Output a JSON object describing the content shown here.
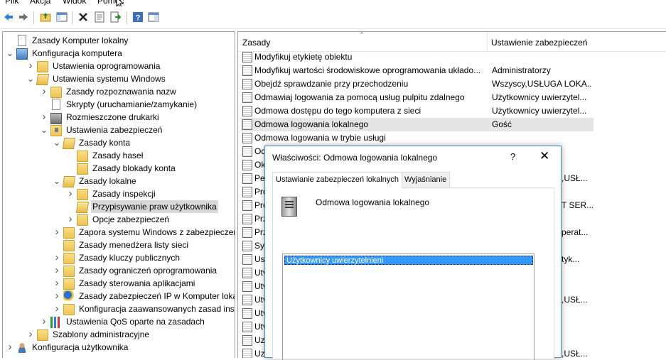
{
  "menu": [
    "Plik",
    "Akcja",
    "Widok",
    "Pomoc"
  ],
  "toolbar": {
    "icons": [
      "back-arrow-icon",
      "forward-arrow-icon",
      "up-folder-icon",
      "show-hide-tree-icon",
      "delete-icon",
      "properties-icon",
      "export-list-icon",
      "help-icon",
      "show-pane-icon"
    ]
  },
  "tree": [
    {
      "label": "Zasady Komputer lokalny",
      "icon": "policy-doc-icon",
      "expander": ""
    },
    {
      "label": "Konfiguracja komputera",
      "icon": "computer-icon",
      "expander": "v"
    },
    {
      "label": "Ustawienia oprogramowania",
      "icon": "folder-icon",
      "expander": ">"
    },
    {
      "label": "Ustawienia systemu Windows",
      "icon": "folder-open-icon",
      "expander": "v"
    },
    {
      "label": "Zasady rozpoznawania nazw",
      "icon": "folder-icon",
      "expander": ">"
    },
    {
      "label": "Skrypty (uruchamianie/zamykanie)",
      "icon": "script-doc-icon",
      "expander": ""
    },
    {
      "label": "Rozmieszczone drukarki",
      "icon": "printer-icon",
      "expander": ">"
    },
    {
      "label": "Ustawienia zabezpieczeń",
      "icon": "security-folder-icon",
      "expander": "v"
    },
    {
      "label": "Zasady konta",
      "icon": "folder-open-icon",
      "expander": "v"
    },
    {
      "label": "Zasady haseł",
      "icon": "folder-icon",
      "expander": ""
    },
    {
      "label": "Zasady blokady konta",
      "icon": "folder-icon",
      "expander": ""
    },
    {
      "label": "Zasady lokalne",
      "icon": "folder-open-icon",
      "expander": "v"
    },
    {
      "label": "Zasady inspekcji",
      "icon": "folder-icon",
      "expander": ">"
    },
    {
      "label": "Przypisywanie praw użytkownika",
      "icon": "folder-open-icon",
      "expander": ""
    },
    {
      "label": "Opcje zabezpieczeń",
      "icon": "folder-icon",
      "expander": ">"
    },
    {
      "label": "Zapora systemu Windows z zabezpieczenia",
      "icon": "folder-icon",
      "expander": ">"
    },
    {
      "label": "Zasady menedżera listy sieci",
      "icon": "folder-icon",
      "expander": ""
    },
    {
      "label": "Zasady kluczy publicznych",
      "icon": "folder-icon",
      "expander": ">"
    },
    {
      "label": "Zasady ograniczeń oprogramowania",
      "icon": "folder-icon",
      "expander": ">"
    },
    {
      "label": "Zasady sterowania aplikacjami",
      "icon": "folder-icon",
      "expander": ">"
    },
    {
      "label": "Zasady zabezpieczeń IP w Komputer lokaln",
      "icon": "ip-security-icon",
      "expander": ">"
    },
    {
      "label": "Konfiguracja zaawansowanych zasad inspe",
      "icon": "folder-icon",
      "expander": ">"
    },
    {
      "label": "Ustawienia QoS oparte na zasadach",
      "icon": "qos-chart-icon",
      "expander": ">"
    },
    {
      "label": "Szablony administracyjne",
      "icon": "folder-icon",
      "expander": ">"
    },
    {
      "label": "Konfiguracja użytkownika",
      "icon": "user-icon",
      "expander": ">"
    }
  ],
  "list": {
    "col_policy": "Zasady",
    "col_setting": "Ustawienie zabezpieczeń",
    "rows": [
      {
        "name": "Modyfikuj etykietę obiektu",
        "value": ""
      },
      {
        "name": "Modyfikuj wartości środowiskowe oprogramowania układo...",
        "value": "Administratorzy"
      },
      {
        "name": "Obejdź sprawdzanie przy przechodzeniu",
        "value": "Wszyscy,USŁUGA LOKA..."
      },
      {
        "name": "Odmawiaj logowania za pomocą usług pulpitu zdalnego",
        "value": "Użytkownicy uwierzytel..."
      },
      {
        "name": "Odmowa dostępu do tego komputera z sieci",
        "value": "Użytkownicy uwierzytel..."
      },
      {
        "name": "Odmowa logowania lokalnego",
        "value": "Gość"
      },
      {
        "name": "Odmowa logowania w trybie usługi",
        "value": ""
      },
      {
        "name": "Od",
        "value": ""
      },
      {
        "name": "Ok",
        "value": ""
      },
      {
        "name": "Per",
        "value": ""
      },
      {
        "name": "Pro",
        "value": ""
      },
      {
        "name": "Pro",
        "value": ""
      },
      {
        "name": "Prz",
        "value": ""
      },
      {
        "name": "Prz",
        "value": ""
      },
      {
        "name": "Syn",
        "value": ""
      },
      {
        "name": "Usu",
        "value": ""
      },
      {
        "name": "Utv",
        "value": ""
      },
      {
        "name": "Utv",
        "value": ""
      },
      {
        "name": "Utv",
        "value": ""
      },
      {
        "name": "Utv",
        "value": ""
      },
      {
        "name": "Utv",
        "value": ""
      },
      {
        "name": "Uzy",
        "value": ""
      },
      {
        "name": "Uzy",
        "value": ""
      }
    ],
    "right_fragments": [
      ",USŁ...",
      "T SER...",
      "perat...",
      "tyk...",
      ",USŁ...",
      ",USŁ..."
    ]
  },
  "dialog": {
    "title": "Właściwości: Odmowa logowania lokalnego",
    "help": "?",
    "close": "✕",
    "tabs": [
      "Ustawianie zabezpieczeń lokalnych",
      "Wyjaśnianie"
    ],
    "policy_name": "Odmowa logowania lokalnego",
    "members": [
      "Użytkownicy uwierzytelnieni"
    ]
  }
}
